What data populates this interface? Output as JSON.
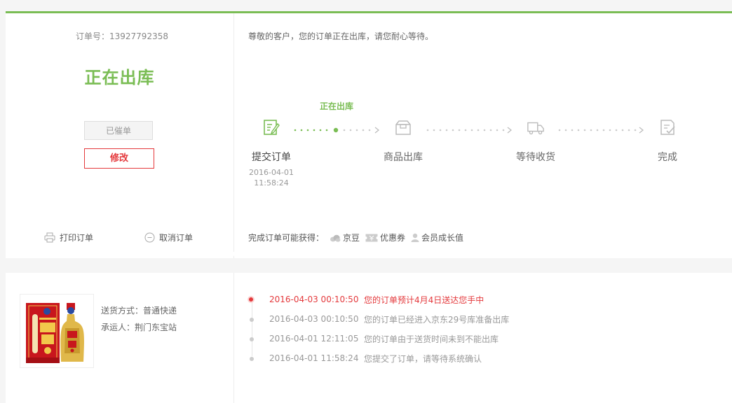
{
  "order": {
    "number_label": "订单号：13927792358",
    "status": "正在出库",
    "urged_label": "已催单",
    "modify_label": "修改",
    "print_label": "打印订单",
    "cancel_label": "取消订单"
  },
  "progress": {
    "notice": "尊敬的客户，您的订单正在出库，请您耐心等待。",
    "current_label": "正在出库",
    "steps": [
      {
        "name": "提交订单",
        "date": "2016-04-01",
        "time": "11:58:24",
        "icon": "edit-icon"
      },
      {
        "name": "商品出库",
        "icon": "package-icon"
      },
      {
        "name": "等待收货",
        "icon": "truck-icon"
      },
      {
        "name": "完成",
        "icon": "check-document-icon"
      }
    ]
  },
  "rewards": {
    "label": "完成订单可能获得：",
    "items": [
      {
        "label": "京豆",
        "icon": "bean-icon"
      },
      {
        "label": "优惠券",
        "icon": "coupon-icon"
      },
      {
        "label": "会员成长值",
        "icon": "user-icon"
      }
    ]
  },
  "shipping": {
    "method": "送货方式：普通快递",
    "carrier": "承运人：荆门东宝站"
  },
  "tracking": [
    {
      "time": "2016-04-03 00:10:50",
      "text": "您的订单预计4月4日送达您手中",
      "current": true
    },
    {
      "time": "2016-04-03 00:10:50",
      "text": "您的订单已经进入京东29号库准备出库"
    },
    {
      "time": "2016-04-01 12:11:05",
      "text": "您的订单由于送货时间未到不能出库"
    },
    {
      "time": "2016-04-01 11:58:24",
      "text": "您提交了订单，请等待系统确认"
    }
  ],
  "colors": {
    "accent_green": "#7abd54",
    "accent_red": "#e4393c"
  }
}
